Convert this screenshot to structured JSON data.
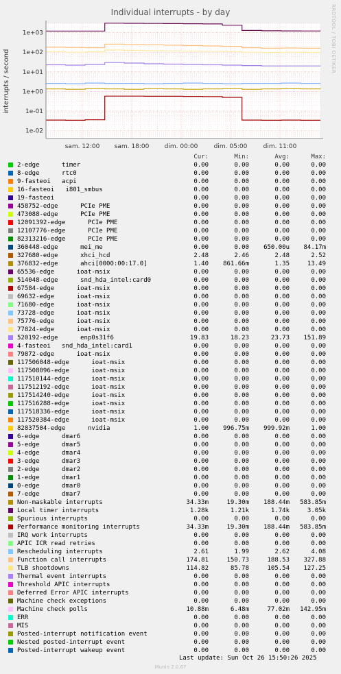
{
  "title": "Individual interrupts - by day",
  "watermark": "RRDTOOL / TOBI OETIKER",
  "chart_data": {
    "type": "line",
    "title": "Individual interrupts - by day",
    "ylabel": "interrupts / second",
    "yscale": "log",
    "ylim": [
      0.004,
      3000
    ],
    "yticks": [
      {
        "value": 0.01,
        "label": "1e-02"
      },
      {
        "value": 0.1,
        "label": "1e-01"
      },
      {
        "value": 1,
        "label": "1e+00"
      },
      {
        "value": 10,
        "label": "1e+01"
      },
      {
        "value": 100,
        "label": "1e+02"
      },
      {
        "value": 1000,
        "label": "1e+03"
      }
    ],
    "xticks": [
      "sam. 12:00",
      "sam. 18:00",
      "dim. 00:00",
      "dim. 05:00",
      "dim. 11:00"
    ],
    "grid": true,
    "series": [
      {
        "name": "Local timer interrupts",
        "color": "#6a0e57",
        "values": [
          1210,
          1210,
          1210,
          3050,
          3000,
          2950,
          2900,
          2850,
          2800,
          2400,
          1300,
          1250,
          1230,
          1220,
          1210
        ]
      },
      {
        "name": "Function call interrupts",
        "color": "#ffc080",
        "values": [
          180,
          175,
          170,
          260,
          250,
          240,
          230,
          220,
          210,
          200,
          170,
          160,
          165,
          160,
          158
        ]
      },
      {
        "name": "TLB shootdowns",
        "color": "#ffe8a0",
        "values": [
          110,
          100,
          105,
          130,
          125,
          120,
          118,
          115,
          112,
          110,
          100,
          98,
          100,
          99,
          97
        ]
      },
      {
        "name": "enp0s31f6",
        "color": "#a080e8",
        "values": [
          23,
          22,
          24,
          30,
          28,
          26,
          25,
          24,
          23,
          22,
          21,
          20,
          20,
          20,
          19.8
        ]
      },
      {
        "name": "Rescheduling interrupts",
        "color": "#80b0ff",
        "values": [
          2.6,
          2.5,
          2.7,
          2.6,
          2.6,
          2.5,
          2.6,
          2.7,
          2.6,
          2.5,
          2.6,
          2.6,
          2.7,
          2.6,
          2.61
        ]
      },
      {
        "name": "ahci[0000:00:17.0]",
        "color": "#c8a000",
        "values": [
          1.35,
          1.3,
          1.4,
          1.35,
          1.3,
          1.4,
          1.35,
          1.3,
          1.35,
          1.4,
          1.3,
          1.35,
          1.4,
          1.35,
          1.4
        ]
      },
      {
        "name": "Non-maskable interrupts",
        "color": "#a00000",
        "values": [
          0.035,
          0.034,
          0.036,
          0.58,
          0.58,
          0.57,
          0.57,
          0.56,
          0.55,
          0.5,
          0.035,
          0.034,
          0.035,
          0.034,
          0.034
        ]
      }
    ]
  },
  "legend_header": {
    "cur": "Cur:",
    "min": "Min:",
    "avg": "Avg:",
    "max": "Max:"
  },
  "legend": [
    {
      "name": "2-edge      timer",
      "color": "#00cc00",
      "cur": "0.00",
      "min": "0.00",
      "avg": "0.00",
      "max": "0.00"
    },
    {
      "name": "8-edge      rtc0",
      "color": "#0066b3",
      "cur": "0.00",
      "min": "0.00",
      "avg": "0.00",
      "max": "0.00"
    },
    {
      "name": "9-fasteoi   acpi",
      "color": "#ff8000",
      "cur": "0.00",
      "min": "0.00",
      "avg": "0.00",
      "max": "0.00"
    },
    {
      "name": "16-fasteoi   i801_smbus",
      "color": "#ffcc00",
      "cur": "0.00",
      "min": "0.00",
      "avg": "0.00",
      "max": "0.00"
    },
    {
      "name": "19-fasteoi",
      "color": "#330099",
      "cur": "0.00",
      "min": "0.00",
      "avg": "0.00",
      "max": "0.00"
    },
    {
      "name": "458752-edge      PCIe PME",
      "color": "#990099",
      "cur": "0.00",
      "min": "0.00",
      "avg": "0.00",
      "max": "0.00"
    },
    {
      "name": "473088-edge      PCIe PME",
      "color": "#ccff00",
      "cur": "0.00",
      "min": "0.00",
      "avg": "0.00",
      "max": "0.00"
    },
    {
      "name": "12091392-edge      PCIe PME",
      "color": "#ff0000",
      "cur": "0.00",
      "min": "0.00",
      "avg": "0.00",
      "max": "0.00"
    },
    {
      "name": "12107776-edge      PCIe PME",
      "color": "#808080",
      "cur": "0.00",
      "min": "0.00",
      "avg": "0.00",
      "max": "0.00"
    },
    {
      "name": "82313216-edge      PCIe PME",
      "color": "#008f00",
      "cur": "0.00",
      "min": "0.00",
      "avg": "0.00",
      "max": "0.00"
    },
    {
      "name": "360448-edge      mei_me",
      "color": "#00487d",
      "cur": "0.00",
      "min": "0.00",
      "avg": "650.00u",
      "max": "84.17m"
    },
    {
      "name": "327680-edge      xhci_hcd",
      "color": "#b35a00",
      "cur": "2.48",
      "min": "2.46",
      "avg": "2.48",
      "max": "2.52"
    },
    {
      "name": "376832-edge      ahci[0000:00:17.0]",
      "color": "#b38f00",
      "cur": "1.40",
      "min": "861.66m",
      "avg": "1.35",
      "max": "13.49"
    },
    {
      "name": "65536-edge      ioat-msix",
      "color": "#6b006b",
      "cur": "0.00",
      "min": "0.00",
      "avg": "0.00",
      "max": "0.00"
    },
    {
      "name": "514048-edge      snd_hda_intel:card0",
      "color": "#8fb300",
      "cur": "0.00",
      "min": "0.00",
      "avg": "0.00",
      "max": "0.00"
    },
    {
      "name": "67584-edge      ioat-msix",
      "color": "#b30000",
      "cur": "0.00",
      "min": "0.00",
      "avg": "0.00",
      "max": "0.00"
    },
    {
      "name": "69632-edge      ioat-msix",
      "color": "#bebebe",
      "cur": "0.00",
      "min": "0.00",
      "avg": "0.00",
      "max": "0.00"
    },
    {
      "name": "71680-edge      ioat-msix",
      "color": "#80ff80",
      "cur": "0.00",
      "min": "0.00",
      "avg": "0.00",
      "max": "0.00"
    },
    {
      "name": "73728-edge      ioat-msix",
      "color": "#80c9ff",
      "cur": "0.00",
      "min": "0.00",
      "avg": "0.00",
      "max": "0.00"
    },
    {
      "name": "75776-edge      ioat-msix",
      "color": "#ffc080",
      "cur": "0.00",
      "min": "0.00",
      "avg": "0.00",
      "max": "0.00"
    },
    {
      "name": "77824-edge      ioat-msix",
      "color": "#ffe680",
      "cur": "0.00",
      "min": "0.00",
      "avg": "0.00",
      "max": "0.00"
    },
    {
      "name": "520192-edge      enp0s31f6",
      "color": "#aa80ff",
      "cur": "19.83",
      "min": "18.23",
      "avg": "23.73",
      "max": "151.89"
    },
    {
      "name": "4-fasteoi   snd_hda_intel:card1",
      "color": "#ee00cc",
      "cur": "0.00",
      "min": "0.00",
      "avg": "0.00",
      "max": "0.00"
    },
    {
      "name": "79872-edge      ioat-msix",
      "color": "#ff8080",
      "cur": "0.00",
      "min": "0.00",
      "avg": "0.00",
      "max": "0.00"
    },
    {
      "name": "117506048-edge      ioat-msix",
      "color": "#666600",
      "cur": "0.00",
      "min": "0.00",
      "avg": "0.00",
      "max": "0.00"
    },
    {
      "name": "117508096-edge      ioat-msix",
      "color": "#ffbfff",
      "cur": "0.00",
      "min": "0.00",
      "avg": "0.00",
      "max": "0.00"
    },
    {
      "name": "117510144-edge      ioat-msix",
      "color": "#00ffcc",
      "cur": "0.00",
      "min": "0.00",
      "avg": "0.00",
      "max": "0.00"
    },
    {
      "name": "117512192-edge      ioat-msix",
      "color": "#cc6699",
      "cur": "0.00",
      "min": "0.00",
      "avg": "0.00",
      "max": "0.00"
    },
    {
      "name": "117514240-edge      ioat-msix",
      "color": "#999900",
      "cur": "0.00",
      "min": "0.00",
      "avg": "0.00",
      "max": "0.00"
    },
    {
      "name": "117516288-edge      ioat-msix",
      "color": "#00cc00",
      "cur": "0.00",
      "min": "0.00",
      "avg": "0.00",
      "max": "0.00"
    },
    {
      "name": "117518336-edge      ioat-msix",
      "color": "#0066b3",
      "cur": "0.00",
      "min": "0.00",
      "avg": "0.00",
      "max": "0.00"
    },
    {
      "name": "117520384-edge      ioat-msix",
      "color": "#ff8000",
      "cur": "0.00",
      "min": "0.00",
      "avg": "0.00",
      "max": "0.00"
    },
    {
      "name": "82837504-edge      nvidia",
      "color": "#ffcc00",
      "cur": "1.00",
      "min": "996.75m",
      "avg": "999.92m",
      "max": "1.00"
    },
    {
      "name": "6-edge      dmar6",
      "color": "#330099",
      "cur": "0.00",
      "min": "0.00",
      "avg": "0.00",
      "max": "0.00"
    },
    {
      "name": "5-edge      dmar5",
      "color": "#990099",
      "cur": "0.00",
      "min": "0.00",
      "avg": "0.00",
      "max": "0.00"
    },
    {
      "name": "4-edge      dmar4",
      "color": "#ccff00",
      "cur": "0.00",
      "min": "0.00",
      "avg": "0.00",
      "max": "0.00"
    },
    {
      "name": "3-edge      dmar3",
      "color": "#ff0000",
      "cur": "0.00",
      "min": "0.00",
      "avg": "0.00",
      "max": "0.00"
    },
    {
      "name": "2-edge      dmar2",
      "color": "#808080",
      "cur": "0.00",
      "min": "0.00",
      "avg": "0.00",
      "max": "0.00"
    },
    {
      "name": "1-edge      dmar1",
      "color": "#008f00",
      "cur": "0.00",
      "min": "0.00",
      "avg": "0.00",
      "max": "0.00"
    },
    {
      "name": "0-edge      dmar0",
      "color": "#00487d",
      "cur": "0.00",
      "min": "0.00",
      "avg": "0.00",
      "max": "0.00"
    },
    {
      "name": "7-edge      dmar7",
      "color": "#b35a00",
      "cur": "0.00",
      "min": "0.00",
      "avg": "0.00",
      "max": "0.00"
    },
    {
      "name": "Non-maskable interrupts",
      "color": "#b38f00",
      "cur": "34.33m",
      "min": "19.30m",
      "avg": "188.44m",
      "max": "583.85m"
    },
    {
      "name": "Local timer interrupts",
      "color": "#6b006b",
      "cur": "1.28k",
      "min": "1.21k",
      "avg": "1.74k",
      "max": "3.05k"
    },
    {
      "name": "Spurious interrupts",
      "color": "#8fb300",
      "cur": "0.00",
      "min": "0.00",
      "avg": "0.00",
      "max": "0.00"
    },
    {
      "name": "Performance monitoring interrupts",
      "color": "#b30000",
      "cur": "34.33m",
      "min": "19.30m",
      "avg": "188.44m",
      "max": "583.85m"
    },
    {
      "name": "IRQ work interrupts",
      "color": "#bebebe",
      "cur": "0.00",
      "min": "0.00",
      "avg": "0.00",
      "max": "0.00"
    },
    {
      "name": "APIC ICR read retries",
      "color": "#80ff80",
      "cur": "0.00",
      "min": "0.00",
      "avg": "0.00",
      "max": "0.00"
    },
    {
      "name": "Rescheduling interrupts",
      "color": "#80c9ff",
      "cur": "2.61",
      "min": "1.99",
      "avg": "2.62",
      "max": "4.08"
    },
    {
      "name": "Function call interrupts",
      "color": "#ffc080",
      "cur": "174.81",
      "min": "150.73",
      "avg": "188.53",
      "max": "327.88"
    },
    {
      "name": "TLB shootdowns",
      "color": "#ffe680",
      "cur": "114.82",
      "min": "85.78",
      "avg": "105.54",
      "max": "127.25"
    },
    {
      "name": "Thermal event interrupts",
      "color": "#aa80ff",
      "cur": "0.00",
      "min": "0.00",
      "avg": "0.00",
      "max": "0.00"
    },
    {
      "name": "Threshold APIC interrupts",
      "color": "#ee00cc",
      "cur": "0.00",
      "min": "0.00",
      "avg": "0.00",
      "max": "0.00"
    },
    {
      "name": "Deferred Error APIC interrupts",
      "color": "#ff8080",
      "cur": "0.00",
      "min": "0.00",
      "avg": "0.00",
      "max": "0.00"
    },
    {
      "name": "Machine check exceptions",
      "color": "#666600",
      "cur": "0.00",
      "min": "0.00",
      "avg": "0.00",
      "max": "0.00"
    },
    {
      "name": "Machine check polls",
      "color": "#ffbfff",
      "cur": "10.88m",
      "min": "6.48m",
      "avg": "77.02m",
      "max": "142.95m"
    },
    {
      "name": "ERR",
      "color": "#00ffcc",
      "cur": "0.00",
      "min": "0.00",
      "avg": "0.00",
      "max": "0.00"
    },
    {
      "name": "MIS",
      "color": "#cc6699",
      "cur": "0.00",
      "min": "0.00",
      "avg": "0.00",
      "max": "0.00"
    },
    {
      "name": "Posted-interrupt notification event",
      "color": "#999900",
      "cur": "0.00",
      "min": "0.00",
      "avg": "0.00",
      "max": "0.00"
    },
    {
      "name": "Nested posted-interrupt event",
      "color": "#00cc00",
      "cur": "0.00",
      "min": "0.00",
      "avg": "0.00",
      "max": "0.00"
    },
    {
      "name": "Posted-interrupt wakeup event",
      "color": "#0066b3",
      "cur": "0.00",
      "min": "0.00",
      "avg": "0.00",
      "max": "0.00"
    }
  ],
  "last_update": "Last update: Sun Oct 26 15:50:26 2025",
  "footer": "Munin 2.0.67"
}
